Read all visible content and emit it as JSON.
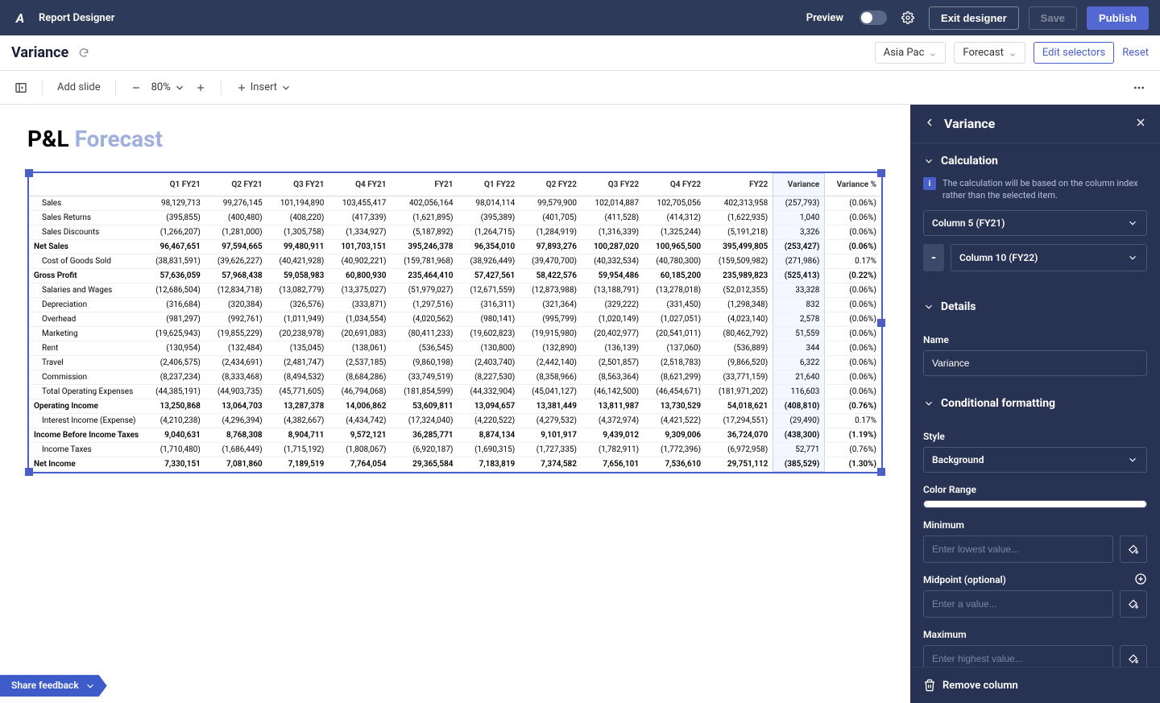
{
  "topbar": {
    "app_title": "Report Designer",
    "preview_label": "Preview",
    "exit_label": "Exit designer",
    "save_label": "Save",
    "publish_label": "Publish"
  },
  "secondary": {
    "page_title": "Variance",
    "selector1": "Asia Pac",
    "selector2": "Forecast",
    "edit_selectors": "Edit selectors",
    "reset": "Reset"
  },
  "toolbar": {
    "add_slide": "Add slide",
    "zoom": "80%",
    "insert": "Insert"
  },
  "slide": {
    "title_a": "P&L ",
    "title_b": "Forecast"
  },
  "table": {
    "headers": [
      "",
      "Q1 FY21",
      "Q2 FY21",
      "Q3 FY21",
      "Q4 FY21",
      "FY21",
      "Q1 FY22",
      "Q2 FY22",
      "Q3 FY22",
      "Q4 FY22",
      "FY22",
      "Variance",
      "Variance %"
    ],
    "rows": [
      {
        "label": "Sales",
        "indent": 1,
        "bold": false,
        "cells": [
          "98,129,713",
          "99,276,145",
          "101,194,890",
          "103,455,417",
          "402,056,164",
          "98,014,114",
          "99,579,900",
          "102,014,887",
          "102,705,056",
          "402,313,958",
          "(257,793)",
          "(0.06%)"
        ]
      },
      {
        "label": "Sales Returns",
        "indent": 1,
        "bold": false,
        "cells": [
          "(395,855)",
          "(400,480)",
          "(408,220)",
          "(417,339)",
          "(1,621,895)",
          "(395,389)",
          "(401,705)",
          "(411,528)",
          "(414,312)",
          "(1,622,935)",
          "1,040",
          "(0.06%)"
        ]
      },
      {
        "label": "Sales Discounts",
        "indent": 1,
        "bold": false,
        "cells": [
          "(1,266,207)",
          "(1,281,000)",
          "(1,305,758)",
          "(1,334,927)",
          "(5,187,892)",
          "(1,264,715)",
          "(1,284,919)",
          "(1,316,339)",
          "(1,325,244)",
          "(5,191,218)",
          "3,326",
          "(0.06%)"
        ]
      },
      {
        "label": "Net Sales",
        "indent": 0,
        "bold": true,
        "cells": [
          "96,467,651",
          "97,594,665",
          "99,480,911",
          "101,703,151",
          "395,246,378",
          "96,354,010",
          "97,893,276",
          "100,287,020",
          "100,965,500",
          "395,499,805",
          "(253,427)",
          "(0.06%)"
        ]
      },
      {
        "label": "Cost of Goods Sold",
        "indent": 1,
        "bold": false,
        "cells": [
          "(38,831,591)",
          "(39,626,227)",
          "(40,421,928)",
          "(40,902,221)",
          "(159,781,968)",
          "(38,926,449)",
          "(39,470,700)",
          "(40,332,534)",
          "(40,780,300)",
          "(159,509,982)",
          "(271,986)",
          "0.17%"
        ]
      },
      {
        "label": "Gross Profit",
        "indent": 0,
        "bold": true,
        "cells": [
          "57,636,059",
          "57,968,438",
          "59,058,983",
          "60,800,930",
          "235,464,410",
          "57,427,561",
          "58,422,576",
          "59,954,486",
          "60,185,200",
          "235,989,823",
          "(525,413)",
          "(0.22%)"
        ]
      },
      {
        "label": "Salaries and Wages",
        "indent": 1,
        "bold": false,
        "cells": [
          "(12,686,504)",
          "(12,834,718)",
          "(13,082,779)",
          "(13,375,027)",
          "(51,979,027)",
          "(12,671,559)",
          "(12,873,988)",
          "(13,188,791)",
          "(13,278,018)",
          "(52,012,355)",
          "33,328",
          "(0.06%)"
        ]
      },
      {
        "label": "Depreciation",
        "indent": 1,
        "bold": false,
        "cells": [
          "(316,684)",
          "(320,384)",
          "(326,576)",
          "(333,871)",
          "(1,297,516)",
          "(316,311)",
          "(321,364)",
          "(329,222)",
          "(331,450)",
          "(1,298,348)",
          "832",
          "(0.06%)"
        ]
      },
      {
        "label": "Overhead",
        "indent": 1,
        "bold": false,
        "cells": [
          "(981,297)",
          "(992,761)",
          "(1,011,949)",
          "(1,034,554)",
          "(4,020,562)",
          "(980,141)",
          "(995,799)",
          "(1,020,149)",
          "(1,027,051)",
          "(4,023,140)",
          "2,578",
          "(0.06%)"
        ]
      },
      {
        "label": "Marketing",
        "indent": 1,
        "bold": false,
        "cells": [
          "(19,625,943)",
          "(19,855,229)",
          "(20,238,978)",
          "(20,691,083)",
          "(80,411,233)",
          "(19,602,823)",
          "(19,915,980)",
          "(20,402,977)",
          "(20,541,011)",
          "(80,462,792)",
          "51,559",
          "(0.06%)"
        ]
      },
      {
        "label": "Rent",
        "indent": 1,
        "bold": false,
        "cells": [
          "(130,954)",
          "(132,484)",
          "(135,045)",
          "(138,061)",
          "(536,545)",
          "(130,800)",
          "(132,890)",
          "(136,139)",
          "(137,060)",
          "(536,889)",
          "344",
          "(0.06%)"
        ]
      },
      {
        "label": "Travel",
        "indent": 1,
        "bold": false,
        "cells": [
          "(2,406,575)",
          "(2,434,691)",
          "(2,481,747)",
          "(2,537,185)",
          "(9,860,198)",
          "(2,403,740)",
          "(2,442,140)",
          "(2,501,857)",
          "(2,518,783)",
          "(9,866,520)",
          "6,322",
          "(0.06%)"
        ]
      },
      {
        "label": "Commission",
        "indent": 1,
        "bold": false,
        "cells": [
          "(8,237,234)",
          "(8,333,468)",
          "(8,494,532)",
          "(8,684,286)",
          "(33,749,519)",
          "(8,227,530)",
          "(8,358,966)",
          "(8,563,364)",
          "(8,621,299)",
          "(33,771,159)",
          "21,640",
          "(0.06%)"
        ]
      },
      {
        "label": "Total Operating Expenses",
        "indent": 1,
        "bold": false,
        "cells": [
          "(44,385,191)",
          "(44,903,735)",
          "(45,771,605)",
          "(46,794,068)",
          "(181,854,599)",
          "(44,332,904)",
          "(45,041,127)",
          "(46,142,500)",
          "(46,454,671)",
          "(181,971,202)",
          "116,603",
          "(0.06%)"
        ]
      },
      {
        "label": "Operating Income",
        "indent": 0,
        "bold": true,
        "cells": [
          "13,250,868",
          "13,064,703",
          "13,287,378",
          "14,006,862",
          "53,609,811",
          "13,094,657",
          "13,381,449",
          "13,811,987",
          "13,730,529",
          "54,018,621",
          "(408,810)",
          "(0.76%)"
        ]
      },
      {
        "label": "Interest Income (Expense)",
        "indent": 1,
        "bold": false,
        "cells": [
          "(4,210,238)",
          "(4,296,394)",
          "(4,382,667)",
          "(4,434,742)",
          "(17,324,040)",
          "(4,220,522)",
          "(4,279,532)",
          "(4,372,974)",
          "(4,421,522)",
          "(17,294,551)",
          "(29,490)",
          "0.17%"
        ]
      },
      {
        "label": "Income Before Income Taxes",
        "indent": 0,
        "bold": true,
        "cells": [
          "9,040,631",
          "8,768,308",
          "8,904,711",
          "9,572,121",
          "36,285,771",
          "8,874,134",
          "9,101,917",
          "9,439,012",
          "9,309,006",
          "36,724,070",
          "(438,300)",
          "(1.19%)"
        ]
      },
      {
        "label": "Income Taxes",
        "indent": 1,
        "bold": false,
        "cells": [
          "(1,710,480)",
          "(1,686,449)",
          "(1,715,192)",
          "(1,808,067)",
          "(6,920,187)",
          "(1,690,315)",
          "(1,727,335)",
          "(1,782,911)",
          "(1,772,396)",
          "(6,972,958)",
          "52,771",
          "(0.76%)"
        ]
      },
      {
        "label": "Net Income",
        "indent": 0,
        "bold": true,
        "cells": [
          "7,330,151",
          "7,081,860",
          "7,189,519",
          "7,764,054",
          "29,365,584",
          "7,183,819",
          "7,374,582",
          "7,656,101",
          "7,536,610",
          "29,751,112",
          "(385,529)",
          "(1.30%)"
        ]
      }
    ],
    "highlight_col_index": 11
  },
  "panel": {
    "title": "Variance",
    "calc_section": "Calculation",
    "calc_info": "The calculation will be based on the column index rather than the selected item.",
    "col_a": "Column 5 (FY21)",
    "op_symbol": "-",
    "col_b": "Column 10 (FY22)",
    "details_section": "Details",
    "name_label": "Name",
    "name_value": "Variance",
    "cond_section": "Conditional formatting",
    "style_label": "Style",
    "style_value": "Background",
    "color_range_label": "Color Range",
    "min_label": "Minimum",
    "min_placeholder": "Enter lowest value...",
    "mid_label": "Midpoint (optional)",
    "mid_placeholder": "Enter a value...",
    "max_label": "Maximum",
    "max_placeholder": "Enter highest value...",
    "remove_label": "Remove column"
  },
  "feedback": {
    "label": "Share feedback"
  }
}
